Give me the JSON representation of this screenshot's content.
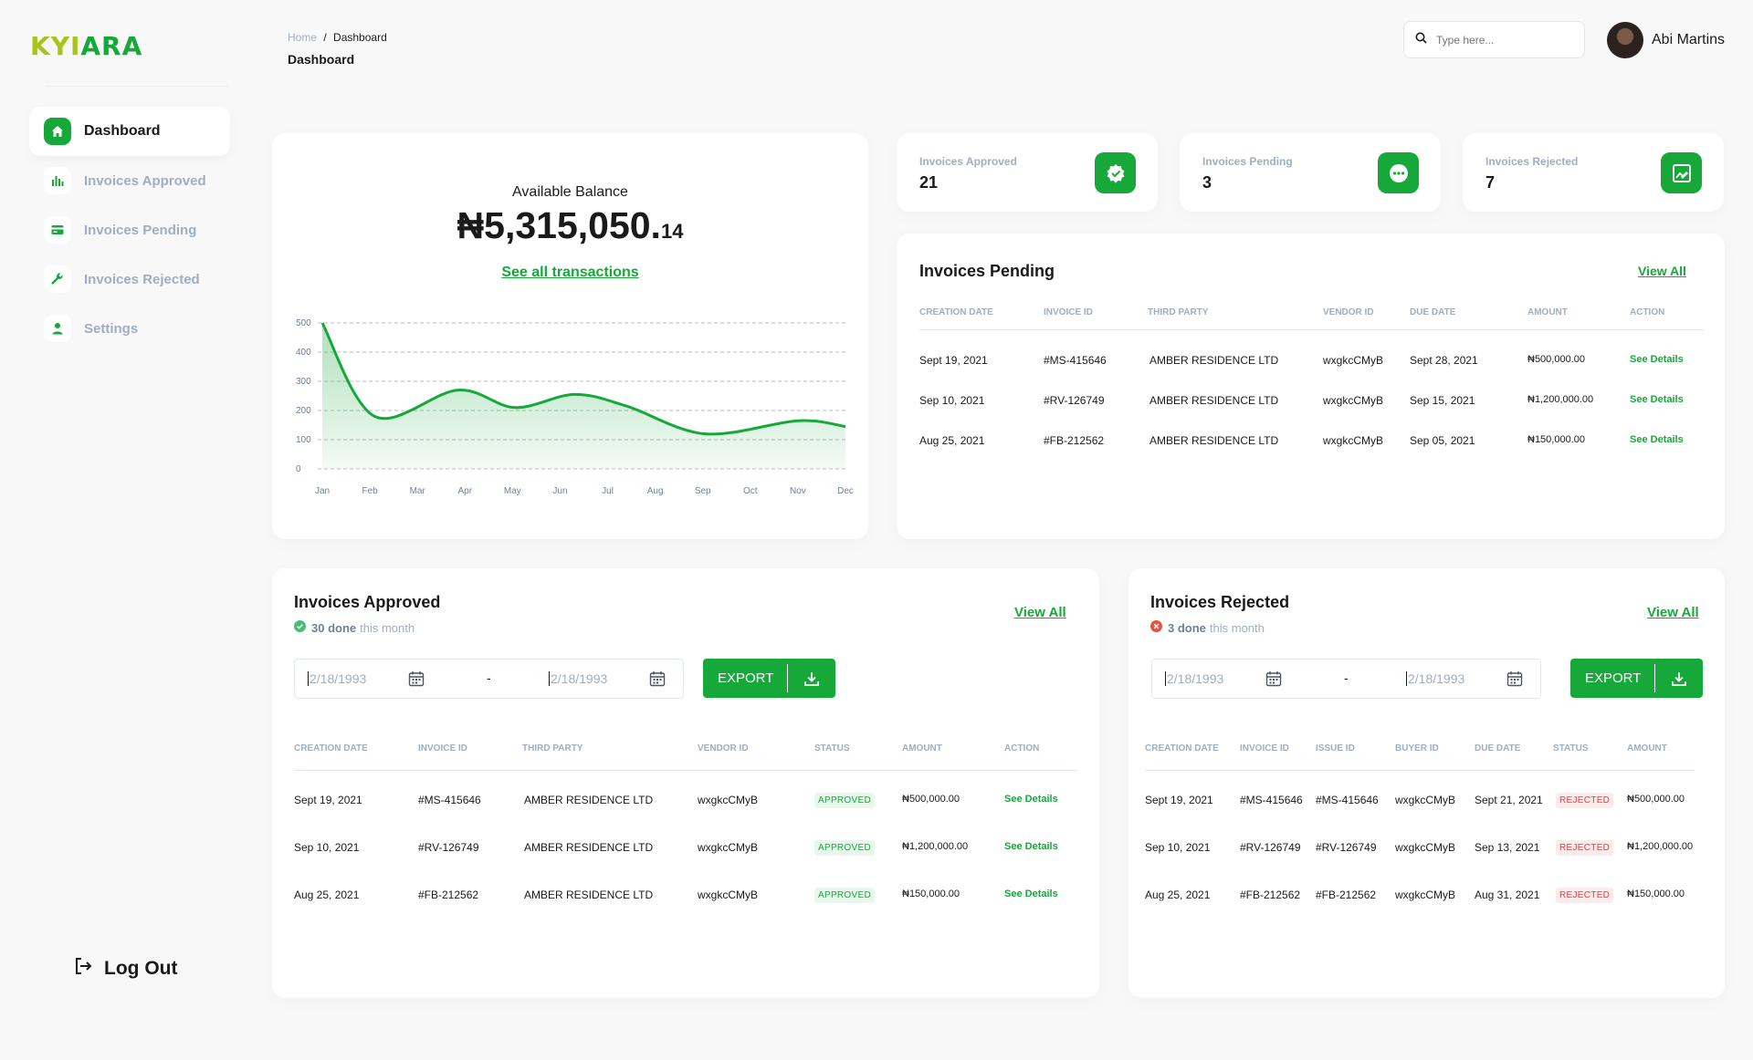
{
  "brand": {
    "logo_a": "KYI",
    "logo_b": "ARA",
    "logo_a_color": "#a6c419",
    "logo_b_color": "#17a83a"
  },
  "accent": "#17a83a",
  "sidebar": {
    "items": [
      {
        "label": "Dashboard",
        "icon": "home-icon",
        "active": true
      },
      {
        "label": "Invoices Approved",
        "icon": "bar-chart-icon"
      },
      {
        "label": "Invoices Pending",
        "icon": "credit-card-icon"
      },
      {
        "label": "Invoices Rejected",
        "icon": "wrench-icon"
      },
      {
        "label": "Settings",
        "icon": "user-icon"
      }
    ],
    "logout_label": "Log Out"
  },
  "header": {
    "breadcrumb_home": "Home",
    "breadcrumb_sep": "/",
    "breadcrumb_current": "Dashboard",
    "title": "Dashboard",
    "search_placeholder": "Type here...",
    "user_name": "Abi Martins"
  },
  "balance": {
    "label": "Available Balance",
    "amount_main": "₦5,315,050.",
    "amount_decimal": "14",
    "link": "See all transactions"
  },
  "chart_data": {
    "type": "area",
    "categories": [
      "Jan",
      "Feb",
      "Mar",
      "Apr",
      "May",
      "Jun",
      "Jul",
      "Aug",
      "Sep",
      "Oct",
      "Nov",
      "Dec"
    ],
    "values": [
      500,
      180,
      270,
      210,
      255,
      215,
      120,
      165,
      145
    ],
    "x_positions": [
      0,
      1.1,
      2.85,
      4.05,
      5.3,
      6.4,
      8.05,
      10.0,
      11.0
    ],
    "yticks": [
      0,
      100,
      200,
      300,
      400,
      500
    ],
    "ylim": [
      0,
      500
    ],
    "grid": true,
    "color": "#17a83a"
  },
  "stats": [
    {
      "label": "Invoices Approved",
      "value": "21",
      "icon": "badge-check-icon"
    },
    {
      "label": "Invoices Pending",
      "value": "3",
      "icon": "more-dots-icon"
    },
    {
      "label": "Invoices Rejected",
      "value": "7",
      "icon": "image-edit-icon"
    }
  ],
  "pending": {
    "title": "Invoices Pending",
    "view_all": "View All",
    "headers": [
      "CREATION DATE",
      "INVOICE ID",
      "THIRD PARTY",
      "VENDOR ID",
      "DUE DATE",
      "AMOUNT",
      "ACTION"
    ],
    "rows": [
      [
        "Sept 19, 2021",
        "#MS-415646",
        "AMBER RESIDENCE LTD",
        "wxgkcCMyB",
        "Sept 28, 2021",
        "₦500,000.00",
        "See Details"
      ],
      [
        "Sep 10, 2021",
        "#RV-126749",
        "AMBER RESIDENCE LTD",
        "wxgkcCMyB",
        "Sep 15, 2021",
        "₦1,200,000.00",
        "See Details"
      ],
      [
        "Aug 25, 2021",
        "#FB-212562",
        "AMBER RESIDENCE LTD",
        "wxgkcCMyB",
        "Sep 05, 2021",
        "₦150,000.00",
        "See Details"
      ]
    ]
  },
  "approved": {
    "title": "Invoices Approved",
    "done_count": "30 done",
    "done_suffix": "this month",
    "view_all": "View All",
    "date_from": "2/18/1993",
    "date_to": "2/18/1993",
    "date_sep": "-",
    "export_label": "EXPORT",
    "headers": [
      "CREATION DATE",
      "INVOICE ID",
      "THIRD PARTY",
      "VENDOR ID",
      "STATUS",
      "AMOUNT",
      "ACTION"
    ],
    "rows": [
      [
        "Sept 19, 2021",
        "#MS-415646",
        "AMBER RESIDENCE LTD",
        "wxgkcCMyB",
        "APPROVED",
        "₦500,000.00",
        "See Details"
      ],
      [
        "Sep 10, 2021",
        "#RV-126749",
        "AMBER RESIDENCE LTD",
        "wxgkcCMyB",
        "APPROVED",
        "₦1,200,000.00",
        "See Details"
      ],
      [
        "Aug 25, 2021",
        "#FB-212562",
        "AMBER RESIDENCE LTD",
        "wxgkcCMyB",
        "APPROVED",
        "₦150,000.00",
        "See Details"
      ]
    ]
  },
  "rejected": {
    "title": "Invoices Rejected",
    "done_count": "3 done",
    "done_suffix": "this month",
    "view_all": "View All",
    "date_from": "2/18/1993",
    "date_to": "2/18/1993",
    "date_sep": "-",
    "export_label": "EXPORT",
    "headers": [
      "CREATION DATE",
      "INVOICE ID",
      "ISSUE ID",
      "BUYER ID",
      "DUE DATE",
      "STATUS",
      "AMOUNT"
    ],
    "rows": [
      [
        "Sept 19, 2021",
        "#MS-415646",
        "#MS-415646",
        "wxgkcCMyB",
        "Sept 21, 2021",
        "REJECTED",
        "₦500,000.00"
      ],
      [
        "Sep 10, 2021",
        "#RV-126749",
        "#RV-126749",
        "wxgkcCMyB",
        "Sep 13, 2021",
        "REJECTED",
        "₦1,200,000.00"
      ],
      [
        "Aug 25, 2021",
        "#FB-212562",
        "#FB-212562",
        "wxgkcCMyB",
        "Aug 31, 2021",
        "REJECTED",
        "₦150,000.00"
      ]
    ]
  }
}
